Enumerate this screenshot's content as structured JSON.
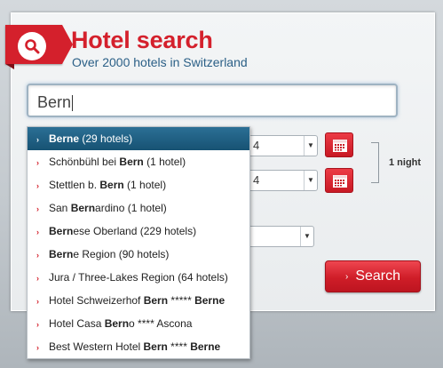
{
  "header": {
    "title": "Hotel search",
    "subtitle": "Over 2000 hotels in Switzerland",
    "badge_icon": "search-icon"
  },
  "search": {
    "value": "Bern"
  },
  "checkin": {
    "day_value": "4"
  },
  "checkout": {
    "day_value": "4"
  },
  "nights_label": "1 night",
  "search_button": {
    "label": "Search"
  },
  "suggestions": [
    {
      "pre": "",
      "bold": "Bern",
      "post": "e (29 hotels)",
      "bold_whole": true
    },
    {
      "pre": "Schönbühl bei ",
      "bold": "Bern",
      "post": " (1 hotel)"
    },
    {
      "pre": "Stettlen b. ",
      "bold": "Bern",
      "post": " (1 hotel)"
    },
    {
      "pre": "San ",
      "bold": "Bern",
      "post": "ardino (1 hotel)"
    },
    {
      "pre": "",
      "bold": "Bern",
      "post": "ese Oberland (229 hotels)"
    },
    {
      "pre": "",
      "bold": "Bern",
      "post": "e Region (90 hotels)"
    },
    {
      "pre": "Jura / Three-Lakes Region (64 hotels)",
      "bold": "",
      "post": ""
    },
    {
      "pre": "Hotel Schweizerhof ",
      "bold": "Bern",
      "post": " ***** ",
      "bold2": "Bern",
      "post2": "e"
    },
    {
      "pre": "Hotel Casa ",
      "bold": "Bern",
      "post": "o **** Ascona"
    },
    {
      "pre": "Best Western Hotel ",
      "bold": "Bern",
      "post": " **** ",
      "bold2": "Bern",
      "post2": "e"
    }
  ],
  "colors": {
    "brand_red": "#d4202c",
    "subtitle_blue": "#2a5f86",
    "active_row": "#1d5a7d"
  }
}
